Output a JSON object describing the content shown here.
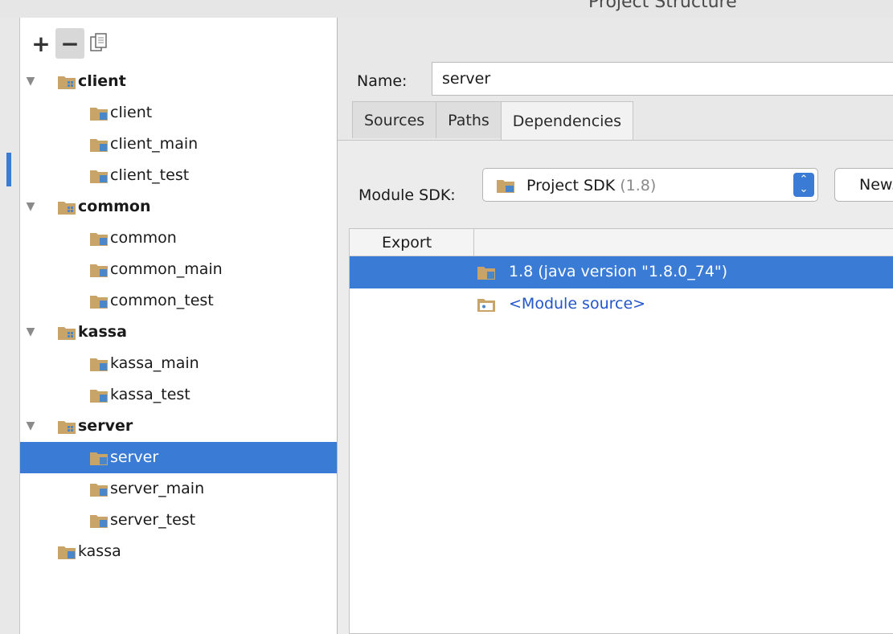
{
  "window": {
    "title": "Project Structure"
  },
  "toolbar": {
    "add": "+",
    "remove": "−",
    "copy": "⧉"
  },
  "tree": [
    {
      "label": "client",
      "bold": true,
      "expanded": true,
      "level": 0,
      "icon": "module-icon"
    },
    {
      "label": "client",
      "bold": false,
      "level": 1,
      "icon": "source-folder-icon"
    },
    {
      "label": "client_main",
      "bold": false,
      "level": 1,
      "icon": "source-folder-icon"
    },
    {
      "label": "client_test",
      "bold": false,
      "level": 1,
      "icon": "source-folder-icon"
    },
    {
      "label": "common",
      "bold": true,
      "expanded": true,
      "level": 0,
      "icon": "module-icon"
    },
    {
      "label": "common",
      "bold": false,
      "level": 1,
      "icon": "source-folder-icon"
    },
    {
      "label": "common_main",
      "bold": false,
      "level": 1,
      "icon": "source-folder-icon"
    },
    {
      "label": "common_test",
      "bold": false,
      "level": 1,
      "icon": "source-folder-icon"
    },
    {
      "label": "kassa",
      "bold": true,
      "expanded": true,
      "level": 0,
      "icon": "module-icon"
    },
    {
      "label": "kassa_main",
      "bold": false,
      "level": 1,
      "icon": "source-folder-icon"
    },
    {
      "label": "kassa_test",
      "bold": false,
      "level": 1,
      "icon": "source-folder-icon"
    },
    {
      "label": "server",
      "bold": true,
      "expanded": true,
      "level": 0,
      "icon": "module-icon"
    },
    {
      "label": "server",
      "bold": false,
      "level": 1,
      "icon": "source-folder-icon",
      "selected": true
    },
    {
      "label": "server_main",
      "bold": false,
      "level": 1,
      "icon": "source-folder-icon"
    },
    {
      "label": "server_test",
      "bold": false,
      "level": 1,
      "icon": "source-folder-icon"
    },
    {
      "label": "kassa",
      "bold": false,
      "level": 0,
      "icon": "source-folder-icon",
      "noArrow": true
    }
  ],
  "details": {
    "name_label": "Name:",
    "name_value": "server",
    "tabs": [
      {
        "label": "Sources",
        "active": false
      },
      {
        "label": "Paths",
        "active": false
      },
      {
        "label": "Dependencies",
        "active": true
      }
    ],
    "sdk_label": "Module SDK:",
    "sdk_value": "Project SDK",
    "sdk_version": "(1.8)",
    "new_button": "New..."
  },
  "dependencies": {
    "columns": [
      "Export"
    ],
    "rows": [
      {
        "text": "1.8 (java version \"1.8.0_74\")",
        "selected": true,
        "link": false,
        "icon": "sdk-folder-icon"
      },
      {
        "text": "<Module source>",
        "selected": false,
        "link": true,
        "icon": "module-source-icon"
      }
    ]
  },
  "colors": {
    "selection": "#3a7bd5",
    "folder": "#c9a468",
    "folder_badge": "#4a87c9",
    "link": "#2255cc"
  }
}
